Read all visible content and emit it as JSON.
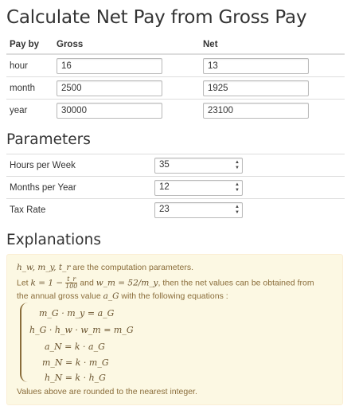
{
  "title": "Calculate Net Pay from Gross Pay",
  "pay_table": {
    "headers": {
      "pay_by": "Pay by",
      "gross": "Gross",
      "net": "Net"
    },
    "rows": [
      {
        "label": "hour",
        "gross": "16",
        "net": "13"
      },
      {
        "label": "month",
        "gross": "2500",
        "net": "1925"
      },
      {
        "label": "year",
        "gross": "30000",
        "net": "23100"
      }
    ]
  },
  "parameters": {
    "heading": "Parameters",
    "rows": [
      {
        "label": "Hours per Week",
        "value": "35"
      },
      {
        "label": "Months per Year",
        "value": "12"
      },
      {
        "label": "Tax Rate",
        "value": "23"
      }
    ]
  },
  "explanations": {
    "heading": "Explanations",
    "params_math": "h_w, m_y, t_r",
    "params_text": "are the computation parameters.",
    "let_prefix": "Let",
    "k_def_left": "k = 1 −",
    "frac_num": "t_r",
    "frac_den": "100",
    "and_text": "and",
    "wm_def": "w_m = 52/m_y",
    "then_text": ", then the net values can be obtained from",
    "annual_text": "the annual gross value",
    "ag_math": "a_G",
    "with_text": "with the following equations :",
    "equations": [
      "m_G · m_y = a_G",
      "h_G · h_w · w_m = m_G",
      "a_N = k · a_G",
      "m_N = k · m_G",
      "h_N = k · h_G"
    ],
    "footer": "Values above are rounded to the nearest integer."
  }
}
